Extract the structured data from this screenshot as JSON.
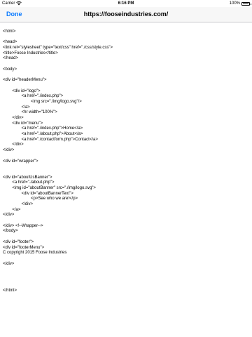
{
  "status_bar": {
    "carrier": "Carrier",
    "time": "6:16 PM",
    "battery": "100%",
    "battery_level": 1.0
  },
  "nav": {
    "done_label": "Done",
    "title": "https://fooseindustries.com/"
  },
  "source_lines": [
    "<html>",
    "",
    "<head>",
    "<link rel=\"stylesheet\" type=\"text/css\" href=\"./css/style.css\">",
    "<title>Foose Industries</title>",
    "</head>",
    "",
    "<body>",
    "",
    "<div id=\"headerMenu\">",
    "",
    "        <div id=\"logo\">",
    "                <a href=\"./index.php\">",
    "                        <img src=\"./img/logo.svg\"/>",
    "                </a>",
    "                <hr width=\"100%\">",
    "        </div>",
    "        <div id=\"menu\">",
    "                <a href=\"./index.php\">Home</a>",
    "                <a href=\"./about.php\">About</a>",
    "                <a href=\"./contactform.php\">Contact</a>",
    "        </div>",
    "</div>",
    "",
    "<div id=\"wrapper\">",
    "",
    "",
    "<div id=\"aboutUsBanner\">",
    "        <a href=\"./about.php\">",
    "        <img id=\"aboutBanner\" src=\"./img/logo.svg\">",
    "                <div id=\"aboutBannerText\">",
    "                        <p>See who we are!</p>",
    "                </div>",
    "        </a>",
    "</div>",
    "",
    "</div> <!--Wrapper-->",
    "</body>",
    "",
    "<div id=\"footer\">",
    "<div id=\"footerMenu\">",
    "C copyright 2015 Foose Industries",
    "",
    "</div>",
    "",
    "",
    "",
    "",
    "</html>"
  ]
}
